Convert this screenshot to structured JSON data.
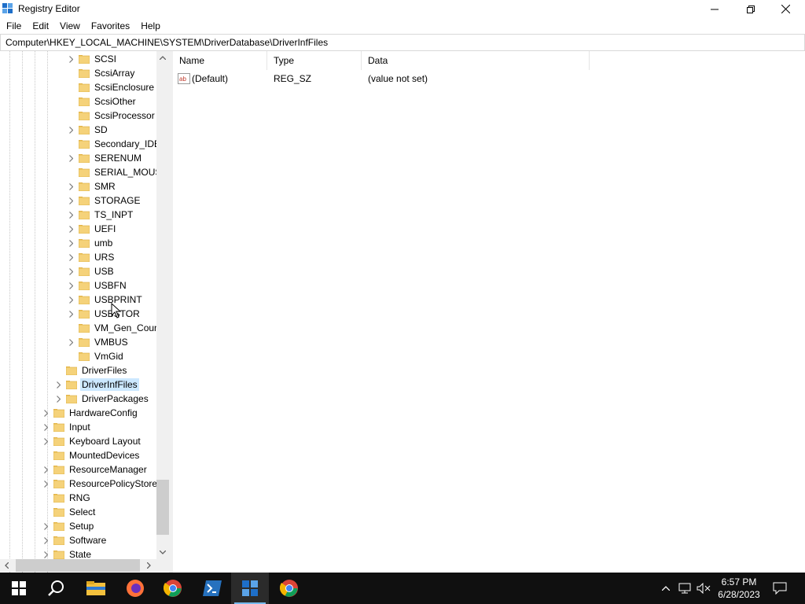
{
  "window": {
    "title": "Registry Editor"
  },
  "menu": [
    "File",
    "Edit",
    "View",
    "Favorites",
    "Help"
  ],
  "address": {
    "path": "Computer\\HKEY_LOCAL_MACHINE\\SYSTEM\\DriverDatabase\\DriverInfFiles"
  },
  "tree": {
    "items": [
      {
        "label": "SCSI",
        "level": 3,
        "expandable": true
      },
      {
        "label": "ScsiArray",
        "level": 3,
        "expandable": false
      },
      {
        "label": "ScsiEnclosure",
        "level": 3,
        "expandable": false
      },
      {
        "label": "ScsiOther",
        "level": 3,
        "expandable": false
      },
      {
        "label": "ScsiProcessor",
        "level": 3,
        "expandable": false
      },
      {
        "label": "SD",
        "level": 3,
        "expandable": true
      },
      {
        "label": "Secondary_IDE_",
        "level": 3,
        "expandable": false
      },
      {
        "label": "SERENUM",
        "level": 3,
        "expandable": true
      },
      {
        "label": "SERIAL_MOUSE",
        "level": 3,
        "expandable": false
      },
      {
        "label": "SMR",
        "level": 3,
        "expandable": true
      },
      {
        "label": "STORAGE",
        "level": 3,
        "expandable": true
      },
      {
        "label": "TS_INPT",
        "level": 3,
        "expandable": true
      },
      {
        "label": "UEFI",
        "level": 3,
        "expandable": true
      },
      {
        "label": "umb",
        "level": 3,
        "expandable": true
      },
      {
        "label": "URS",
        "level": 3,
        "expandable": true
      },
      {
        "label": "USB",
        "level": 3,
        "expandable": true
      },
      {
        "label": "USBFN",
        "level": 3,
        "expandable": true
      },
      {
        "label": "USBPRINT",
        "level": 3,
        "expandable": true
      },
      {
        "label": "USBSTOR",
        "level": 3,
        "expandable": true
      },
      {
        "label": "VM_Gen_Coun",
        "level": 3,
        "expandable": false
      },
      {
        "label": "VMBUS",
        "level": 3,
        "expandable": true
      },
      {
        "label": "VmGid",
        "level": 3,
        "expandable": false
      },
      {
        "label": "DriverFiles",
        "level": 2,
        "expandable": false
      },
      {
        "label": "DriverInfFiles",
        "level": 2,
        "expandable": true,
        "selected": true
      },
      {
        "label": "DriverPackages",
        "level": 2,
        "expandable": true
      },
      {
        "label": "HardwareConfig",
        "level": 1,
        "expandable": true
      },
      {
        "label": "Input",
        "level": 1,
        "expandable": true
      },
      {
        "label": "Keyboard Layout",
        "level": 1,
        "expandable": true
      },
      {
        "label": "MountedDevices",
        "level": 1,
        "expandable": false
      },
      {
        "label": "ResourceManager",
        "level": 1,
        "expandable": true
      },
      {
        "label": "ResourcePolicyStore",
        "level": 1,
        "expandable": true
      },
      {
        "label": "RNG",
        "level": 1,
        "expandable": false
      },
      {
        "label": "Select",
        "level": 1,
        "expandable": false
      },
      {
        "label": "Setup",
        "level": 1,
        "expandable": true
      },
      {
        "label": "Software",
        "level": 1,
        "expandable": true
      },
      {
        "label": "State",
        "level": 1,
        "expandable": true
      }
    ]
  },
  "values": {
    "columns": [
      "Name",
      "Type",
      "Data"
    ],
    "rows": [
      {
        "name": "(Default)",
        "type": "REG_SZ",
        "data": "(value not set)",
        "icon": "string-value-icon"
      }
    ]
  },
  "taskbar": {
    "apps": [
      "start-button",
      "search",
      "file-explorer",
      "firefox",
      "chrome",
      "powershell",
      "registry-editor",
      "chrome-alt"
    ],
    "active": "registry-editor",
    "time": "6:57 PM",
    "date": "6/28/2023"
  },
  "colors": {
    "selection": "#cce8ff",
    "taskbar": "#101010",
    "folder": "#f5d27a"
  }
}
